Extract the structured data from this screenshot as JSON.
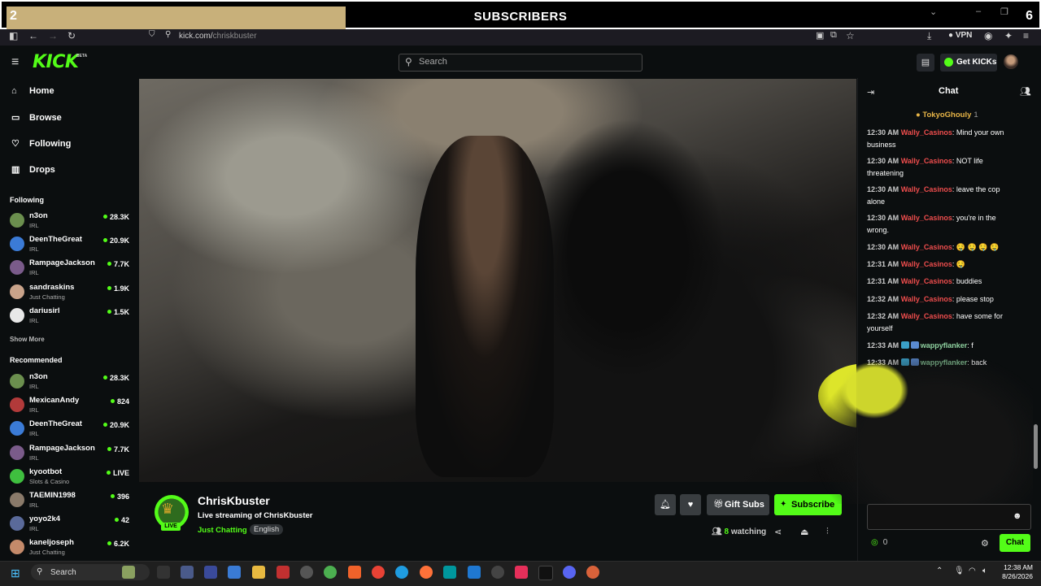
{
  "overlay": {
    "left_count": "2",
    "title": "SUBSCRIBERS",
    "right_count": "6",
    "fill_fraction": 0.33
  },
  "browser": {
    "url_host": "kick.com/",
    "url_path": "chriskbuster",
    "vpn_label": "VPN"
  },
  "header": {
    "logo": "KICK",
    "beta": "BETA",
    "search_placeholder": "Search",
    "get_kicks_label": "Get KICKs"
  },
  "nav": {
    "home": "Home",
    "browse": "Browse",
    "following": "Following",
    "drops": "Drops"
  },
  "following": {
    "heading": "Following",
    "channels": [
      {
        "name": "n3on",
        "category": "IRL",
        "viewers": "28.3K",
        "color": "#6b8f4e"
      },
      {
        "name": "DeenTheGreat",
        "category": "IRL",
        "viewers": "20.9K",
        "color": "#3b7bd6"
      },
      {
        "name": "RampageJackson",
        "category": "IRL",
        "viewers": "7.7K",
        "color": "#7a5b8a"
      },
      {
        "name": "sandraskins",
        "category": "Just Chatting",
        "viewers": "1.9K",
        "color": "#c9a38a"
      },
      {
        "name": "dariusirl",
        "category": "IRL",
        "viewers": "1.5K",
        "color": "#e8e8e8"
      }
    ],
    "show_more": "Show More"
  },
  "recommended": {
    "heading": "Recommended",
    "channels": [
      {
        "name": "n3on",
        "category": "IRL",
        "viewers": "28.3K",
        "color": "#6b8f4e"
      },
      {
        "name": "MexicanAndy",
        "category": "IRL",
        "viewers": "824",
        "color": "#b23a3a"
      },
      {
        "name": "DeenTheGreat",
        "category": "IRL",
        "viewers": "20.9K",
        "color": "#3b7bd6"
      },
      {
        "name": "RampageJackson",
        "category": "IRL",
        "viewers": "7.7K",
        "color": "#7a5b8a"
      },
      {
        "name": "kyootbot",
        "category": "Slots & Casino",
        "viewers": "LIVE",
        "color": "#3fbf3f"
      },
      {
        "name": "TAEMIN1998",
        "category": "IRL",
        "viewers": "396",
        "color": "#8a7a6a"
      },
      {
        "name": "yoyo2k4",
        "category": "IRL",
        "viewers": "42",
        "color": "#5a6a9a"
      },
      {
        "name": "kaneljoseph",
        "category": "Just Chatting",
        "viewers": "6.2K",
        "color": "#c48a6a"
      }
    ]
  },
  "stream": {
    "channel_name": "ChrisKbuster",
    "title": "Live streaming of ChrisKbuster",
    "category": "Just Chatting",
    "language": "English",
    "live_badge": "LIVE",
    "gift_label": "Gift Subs",
    "subscribe_label": "Subscribe",
    "watch_count": "8",
    "watch_suffix": " watching"
  },
  "chat": {
    "title": "Chat",
    "pinned_user": "TokyoGhouly",
    "pinned_count": "1",
    "messages": [
      {
        "time": "12:30 AM",
        "user": "Wally_Casinos",
        "text": ": Mind your own business"
      },
      {
        "time": "12:30 AM",
        "user": "Wally_Casinos",
        "text": ": NOT life threatening"
      },
      {
        "time": "12:30 AM",
        "user": "Wally_Casinos",
        "text": ": leave the cop alone"
      },
      {
        "time": "12:30 AM",
        "user": "Wally_Casinos",
        "text": ": you're in the wrong."
      },
      {
        "time": "12:30 AM",
        "user": "Wally_Casinos",
        "text": ": 🤤 🤤 🤤 🤤"
      },
      {
        "time": "12:31 AM",
        "user": "Wally_Casinos",
        "text": ": 🤤"
      },
      {
        "time": "12:31 AM",
        "user": "Wally_Casinos",
        "text": ": buddies"
      },
      {
        "time": "12:32 AM",
        "user": "Wally_Casinos",
        "text": ": please stop"
      },
      {
        "time": "12:32 AM",
        "user": "Wally_Casinos",
        "text": ": have some for yourself"
      },
      {
        "time": "12:33 AM",
        "user": "wappyflanker",
        "text": ": f"
      },
      {
        "time": "12:33 AM",
        "user": "wappyflanker",
        "text": ": back"
      }
    ],
    "points": "0",
    "send_label": "Chat"
  },
  "taskbar": {
    "search_label": "Search",
    "time": "12:38 AM",
    "date": "8/26/2026"
  }
}
